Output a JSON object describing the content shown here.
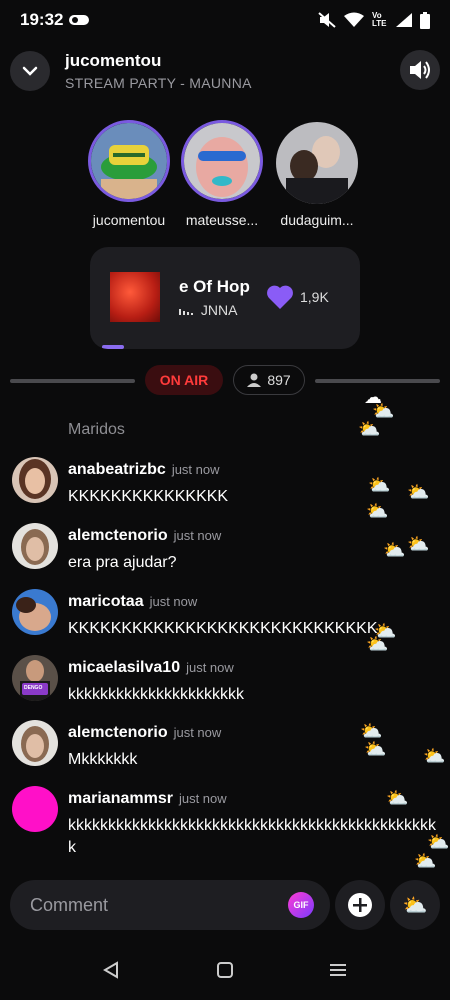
{
  "status_bar": {
    "time": "19:32",
    "icons": [
      "nfc-icon",
      "mute-icon",
      "wifi-icon",
      "volte-icon",
      "signal-icon",
      "battery-icon"
    ],
    "volte_label": "Vo LTE"
  },
  "header": {
    "title": "jucomentou",
    "subtitle": "STREAM PARTY - MAUNNA"
  },
  "participants": [
    {
      "name": "jucomentou"
    },
    {
      "name": "mateusse..."
    },
    {
      "name": "dudaguim..."
    }
  ],
  "now_playing": {
    "title": "e Of Hop",
    "artist": "JNNA",
    "likes": "1,9K",
    "progress_percent": 8
  },
  "live": {
    "badge": "ON AIR",
    "viewers": "897"
  },
  "chat": {
    "group_label": "Maridos",
    "messages": [
      {
        "user": "anabeatrizbc",
        "time": "just now",
        "text": "KKKKKKKKKKKKKKK"
      },
      {
        "user": "alemctenorio",
        "time": "just now",
        "text": "era pra ajudar?"
      },
      {
        "user": "maricotaa",
        "time": "just now",
        "text": "KKKKKKKKKKKKKKKKKKKKKKKKKKKKK"
      },
      {
        "user": "micaelasilva10",
        "time": "just now",
        "text": "kkkkkkkkkkkkkkkkkkkkkk"
      },
      {
        "user": "alemctenorio",
        "time": "just now",
        "text": "Mkkkkkkk"
      },
      {
        "user": "marianammsr",
        "time": "just now",
        "text": "kkkkkkkkkkkkkkkkkkkkkkkkkkkkkkkkkkkkkkkkkkkkkkk"
      }
    ],
    "avatar_badge": "DENGO"
  },
  "comment": {
    "placeholder": "Comment",
    "gif_label": "GIF"
  },
  "colors": {
    "accent_purple": "#7a5ae0",
    "on_air_red": "#ff3b3b",
    "background": "#0b0b0c"
  }
}
